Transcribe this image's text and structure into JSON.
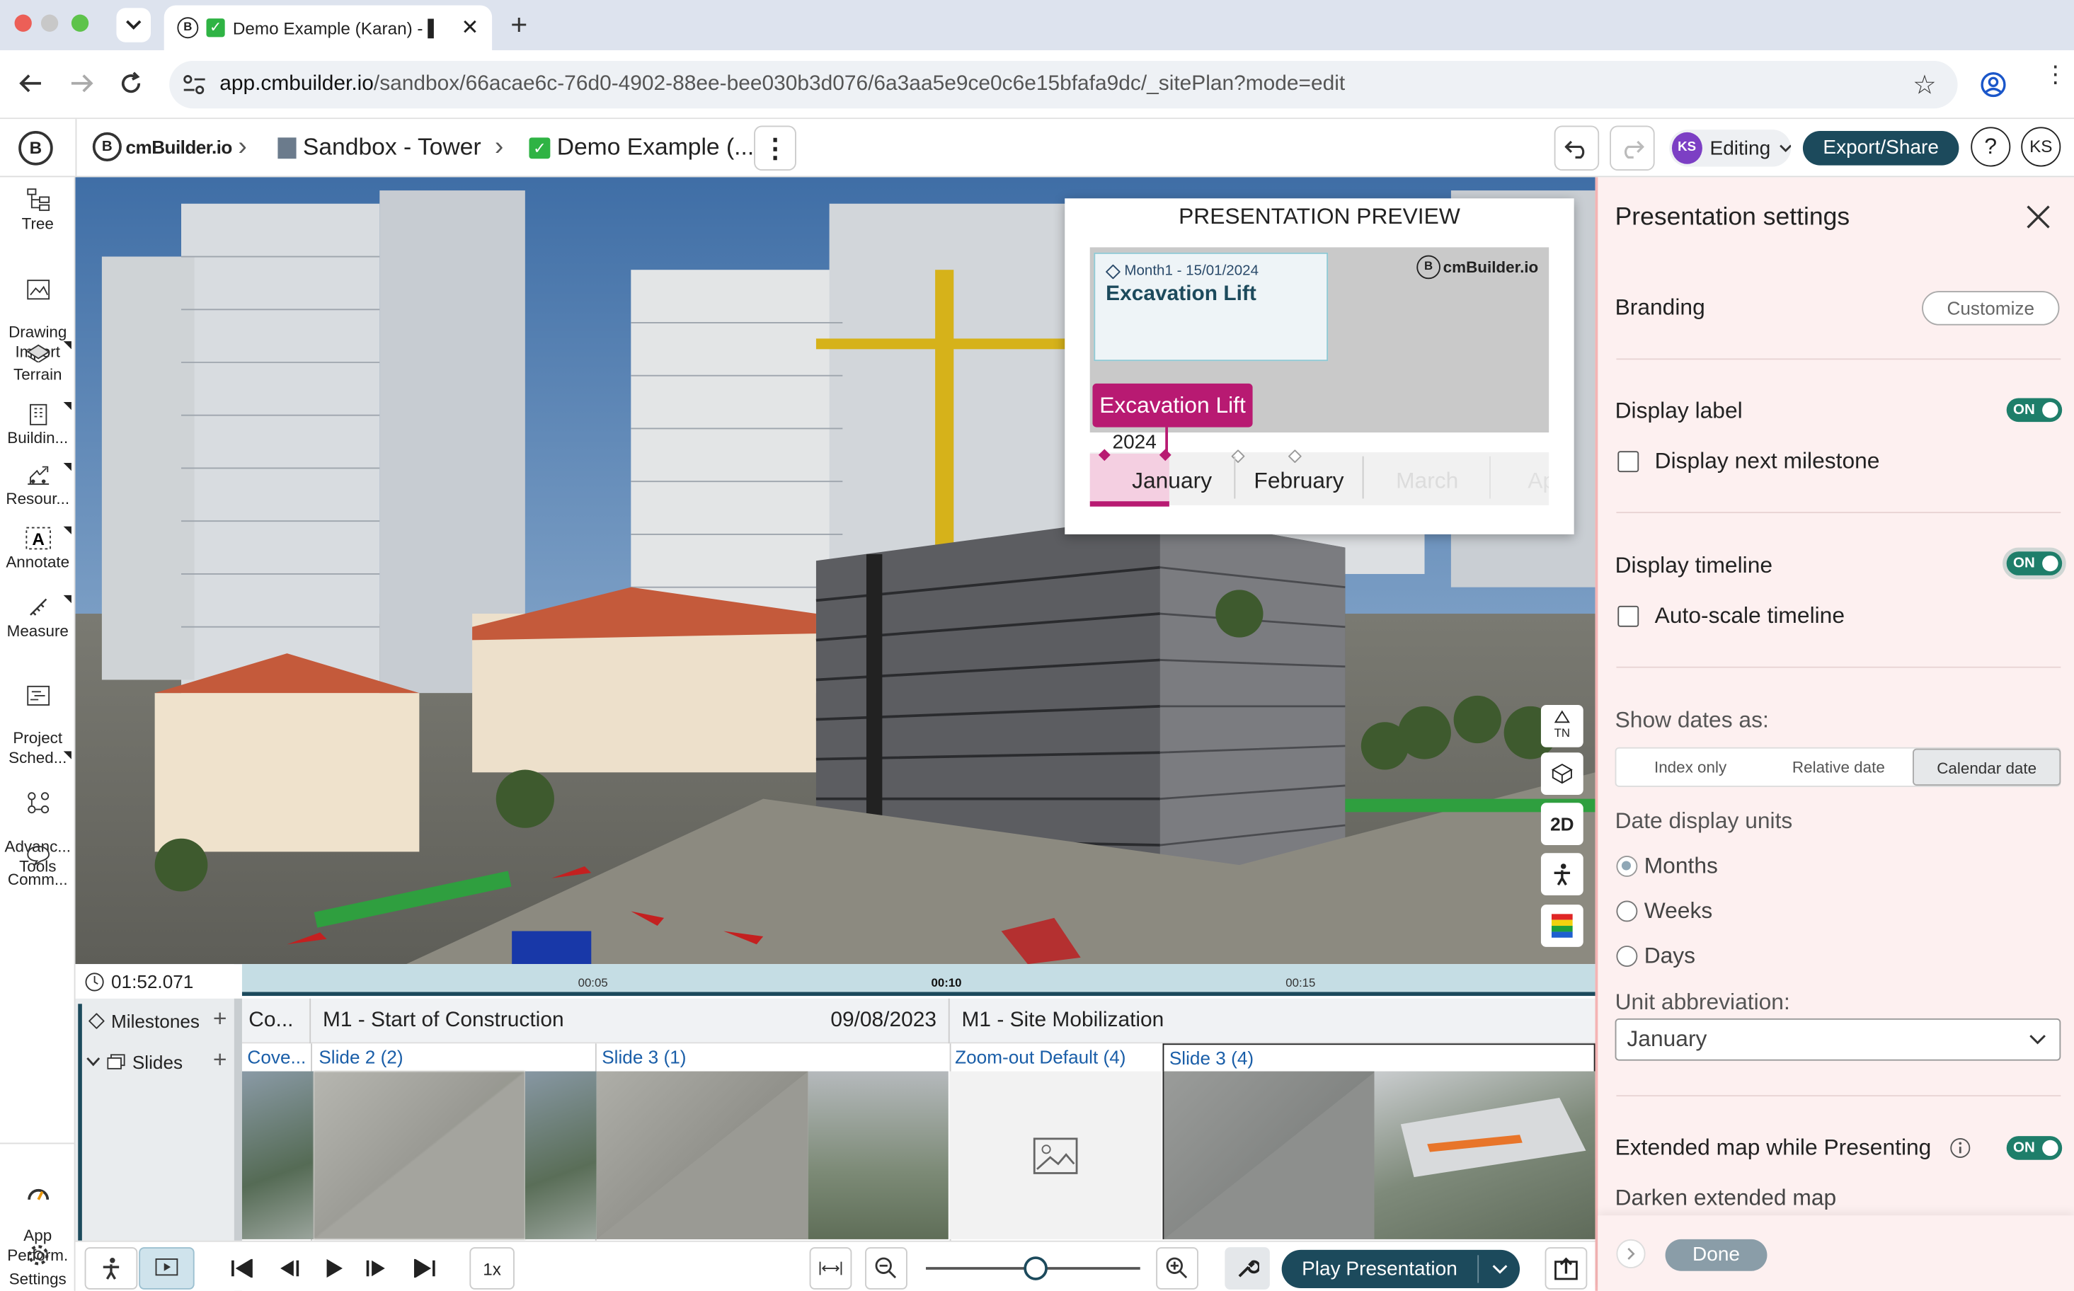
{
  "browser": {
    "tab_title": "Demo Example (Karan) - ▌",
    "url_host": "app.cmbuilder.io",
    "url_path": "/sandbox/66acae6c-76d0-4902-88ee-bee030b3d076/6a3aa5e9ce0c6e15bfafa9dc/_sitePlan?mode=edit"
  },
  "header": {
    "logo": "cmBuilder.io",
    "crumb1": "Sandbox - Tower",
    "crumb2": "Demo Example (...",
    "avatar": "KS",
    "mode": "Editing",
    "export": "Export/Share",
    "help": "?",
    "user": "KS"
  },
  "sidebar": {
    "items": [
      {
        "label": "Tree",
        "icon": "tree-icon"
      },
      {
        "label": "Drawing\nImport",
        "icon": "drawing-import-icon"
      },
      {
        "label": "Terrain",
        "icon": "terrain-icon"
      },
      {
        "label": "Buildin...",
        "icon": "building-icon"
      },
      {
        "label": "Resour...",
        "icon": "resources-icon"
      },
      {
        "label": "Annotate",
        "icon": "annotate-icon"
      },
      {
        "label": "Measure",
        "icon": "measure-icon"
      },
      {
        "label": "Project\nSched...",
        "icon": "project-schedule-icon"
      },
      {
        "label": "Advanc...\nTools",
        "icon": "advanced-tools-icon"
      },
      {
        "label": "Comm...",
        "icon": "comments-icon"
      }
    ],
    "bottom": [
      {
        "label": "App\nPerform.",
        "icon": "app-performance-icon"
      },
      {
        "label": "Settings",
        "icon": "settings-icon"
      }
    ]
  },
  "preview": {
    "title": "PRESENTATION PREVIEW",
    "milestone_meta": "Month1 - 15/01/2024",
    "milestone_name": "Excavation Lift",
    "brand": "cmBuilder.io",
    "pill": "Excavation Lift",
    "year": "2024",
    "months": [
      "January",
      "February",
      "March",
      "Ap"
    ]
  },
  "view_tools": {
    "north": "TN",
    "twod": "2D"
  },
  "timeline": {
    "clock": "01:52.071",
    "ticks": [
      "00:05",
      "00:10",
      "00:15"
    ],
    "milestones_label": "Milestones",
    "slides_label": "Slides",
    "milestone_cells": [
      {
        "name": "Co...",
        "date": ""
      },
      {
        "name": "M1 - Start of Construction",
        "date": "09/08/2023"
      },
      {
        "name": "M1 - Site Mobilization",
        "date": ""
      }
    ],
    "slides": [
      "Cove...",
      "Slide 2 (2)",
      "Slide 3 (1)",
      "Zoom-out Default (4)",
      "Slide 3 (4)"
    ]
  },
  "playback": {
    "speed": "1x",
    "play": "Play Presentation"
  },
  "settings": {
    "title": "Presentation settings",
    "branding": "Branding",
    "customize": "Customize",
    "display_label": "Display label",
    "display_label_on": "ON",
    "next_milestone": "Display next milestone",
    "display_timeline": "Display timeline",
    "display_timeline_on": "ON",
    "auto_scale": "Auto-scale timeline",
    "show_dates": "Show dates as:",
    "seg": [
      "Index only",
      "Relative date",
      "Calendar date"
    ],
    "units_title": "Date display units",
    "units": [
      "Months",
      "Weeks",
      "Days"
    ],
    "abbr_title": "Unit abbreviation:",
    "abbr_value": "January",
    "extended": "Extended map while Presenting",
    "extended_on": "ON",
    "darken": "Darken extended map",
    "done": "Done"
  }
}
